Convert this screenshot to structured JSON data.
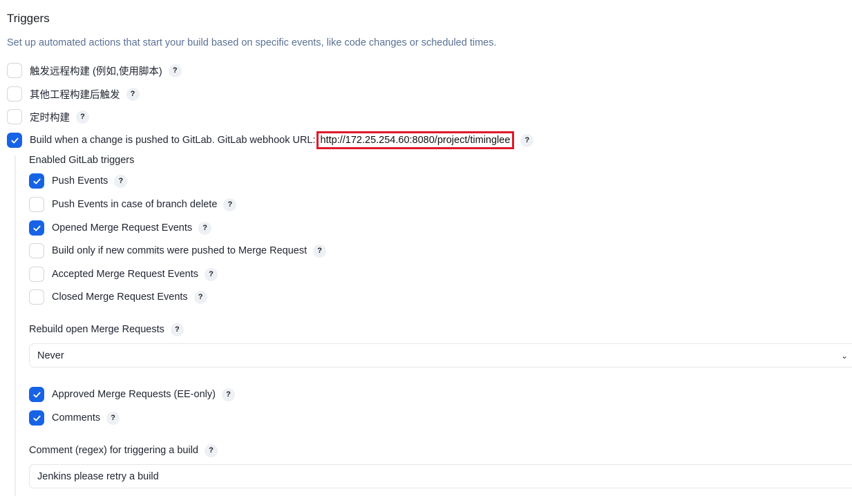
{
  "section": {
    "title": "Triggers",
    "description": "Set up automated actions that start your build based on specific events, like code changes or scheduled times."
  },
  "triggers": [
    {
      "label": "触发远程构建 (例如,使用脚本)",
      "checked": false
    },
    {
      "label": "其他工程构建后触发",
      "checked": false
    },
    {
      "label": "定时构建",
      "checked": false
    }
  ],
  "gitlab_trigger": {
    "label": "Build when a change is pushed to GitLab. GitLab webhook URL:",
    "url": "http://172.25.254.60:8080/project/timinglee",
    "checked": true
  },
  "enabled_triggers_heading": "Enabled GitLab triggers",
  "gitlab_events": [
    {
      "label": "Push Events",
      "checked": true
    },
    {
      "label": "Push Events in case of branch delete",
      "checked": false
    },
    {
      "label": "Opened Merge Request Events",
      "checked": true
    },
    {
      "label": "Build only if new commits were pushed to Merge Request",
      "checked": false
    },
    {
      "label": "Accepted Merge Request Events",
      "checked": false
    },
    {
      "label": "Closed Merge Request Events",
      "checked": false
    }
  ],
  "rebuild": {
    "label": "Rebuild open Merge Requests",
    "selected": "Never"
  },
  "extra_options": [
    {
      "label": "Approved Merge Requests (EE-only)",
      "checked": true
    },
    {
      "label": "Comments",
      "checked": true
    }
  ],
  "comment_regex": {
    "label": "Comment (regex) for triggering a build",
    "value": "Jenkins please retry a build"
  },
  "help_glyph": "?",
  "colors": {
    "accent": "#1663e6",
    "highlight_border": "#e0192b",
    "description": "#5a7194"
  }
}
